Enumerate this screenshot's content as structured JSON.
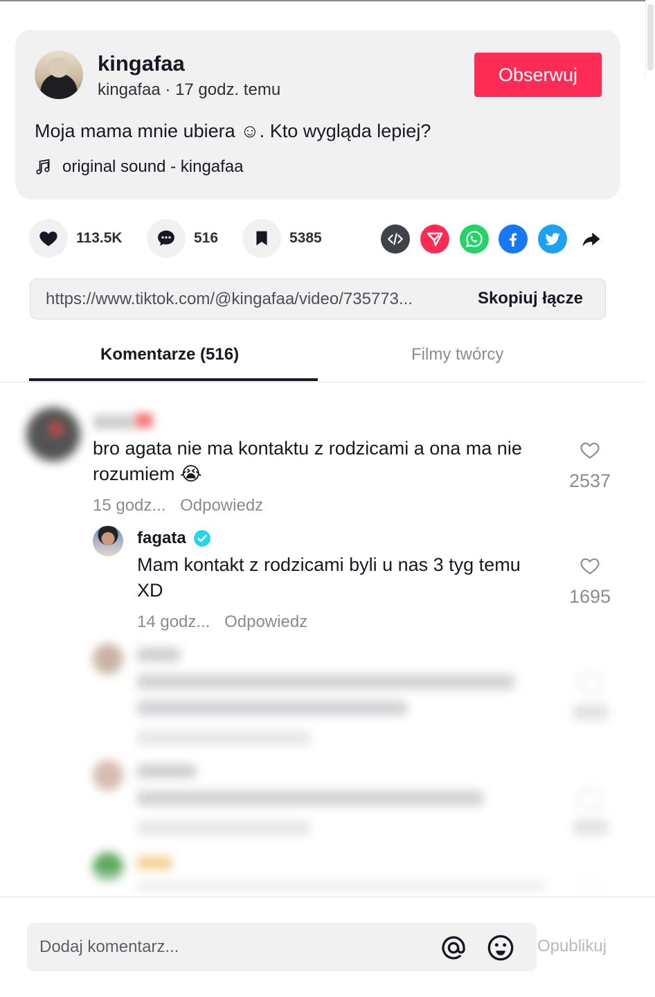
{
  "post": {
    "author_name": "kingafaa",
    "author_meta": "kingafaa · 17 godz. temu",
    "follow_label": "Obserwuj",
    "caption": "Moja mama mnie ubiera ☺. Kto wygląda lepiej?",
    "music": "original sound - kingafaa"
  },
  "actions": {
    "likes": "113.5K",
    "comments": "516",
    "saves": "5385",
    "share_icons": [
      "embed-icon",
      "send-to-friends-icon",
      "whatsapp-icon",
      "facebook-icon",
      "twitter-icon",
      "share-arrow-icon"
    ],
    "colors": {
      "embed": "#3f4248",
      "send": "#fe2c55",
      "whatsapp": "#25d366",
      "facebook": "#1877f2",
      "twitter": "#1da1f2",
      "accent": "#fe2c55"
    }
  },
  "link": {
    "url": "https://www.tiktok.com/@kingafaa/video/735773...",
    "copy_label": "Skopiuj łącze"
  },
  "tabs": {
    "comments": "Komentarze (516)",
    "creator_videos": "Filmy twórcy"
  },
  "comments": [
    {
      "text_line1": "bro agata nie ma kontaktu z rodzicami a ona ma nie",
      "text_line2": "rozumiem 😭",
      "time": "15 godz...",
      "reply_label": "Odpowiedz",
      "likes": "2537"
    },
    {
      "username": "fagata",
      "text_line1": "Mam kontakt z rodzicami byli u nas 3 tyg temu",
      "text_line2": "XD",
      "time": "14 godz...",
      "reply_label": "Odpowiedz",
      "likes": "1695"
    }
  ],
  "composer": {
    "placeholder": "Dodaj komentarz...",
    "post_label": "Opublikuj"
  }
}
